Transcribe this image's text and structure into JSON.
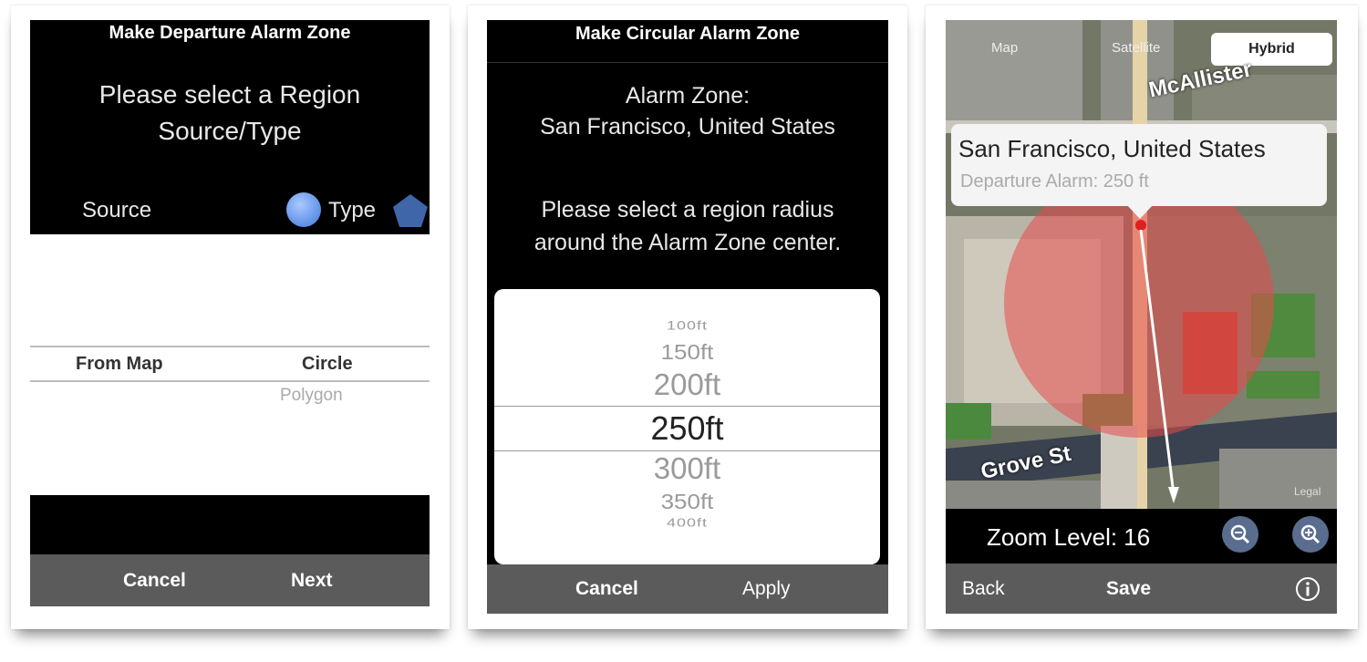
{
  "panel1": {
    "title": "Make Departure Alarm Zone",
    "prompt_line1": "Please select a Region",
    "prompt_line2": "Source/Type",
    "source_label": "Source",
    "type_label": "Type",
    "columns": {
      "source_options": [
        "From Map"
      ],
      "type_options": [
        "Circle",
        "Polygon"
      ]
    },
    "cancel": "Cancel",
    "next": "Next"
  },
  "panel2": {
    "title": "Make Circular Alarm Zone",
    "zone_line1": "Alarm Zone:",
    "zone_line2": "San Francisco, United States",
    "prompt_line1": "Please select a region radius",
    "prompt_line2": "around the Alarm Zone center.",
    "radius_options": [
      "100ft",
      "150ft",
      "200ft",
      "250ft",
      "300ft",
      "350ft",
      "400ft"
    ],
    "selected_radius": "250ft",
    "cancel": "Cancel",
    "apply": "Apply"
  },
  "panel3": {
    "map_types": [
      "Map",
      "Satellite",
      "Hybrid"
    ],
    "selected_map_type": "Hybrid",
    "callout_title": "San Francisco, United States",
    "callout_subtitle": "Departure Alarm: 250 ft",
    "street_labels": [
      "McAllister",
      "Grove St"
    ],
    "legal": "Legal",
    "zoom_label": "Zoom Level: 16",
    "back": "Back",
    "save": "Save",
    "icons": [
      "zoom-out-icon",
      "zoom-in-icon",
      "info-icon"
    ]
  },
  "colors": {
    "toolbar_gray": "#5b5b5b",
    "circle_blue": "#5f8fe6",
    "zone_red": "#e84a4a"
  }
}
